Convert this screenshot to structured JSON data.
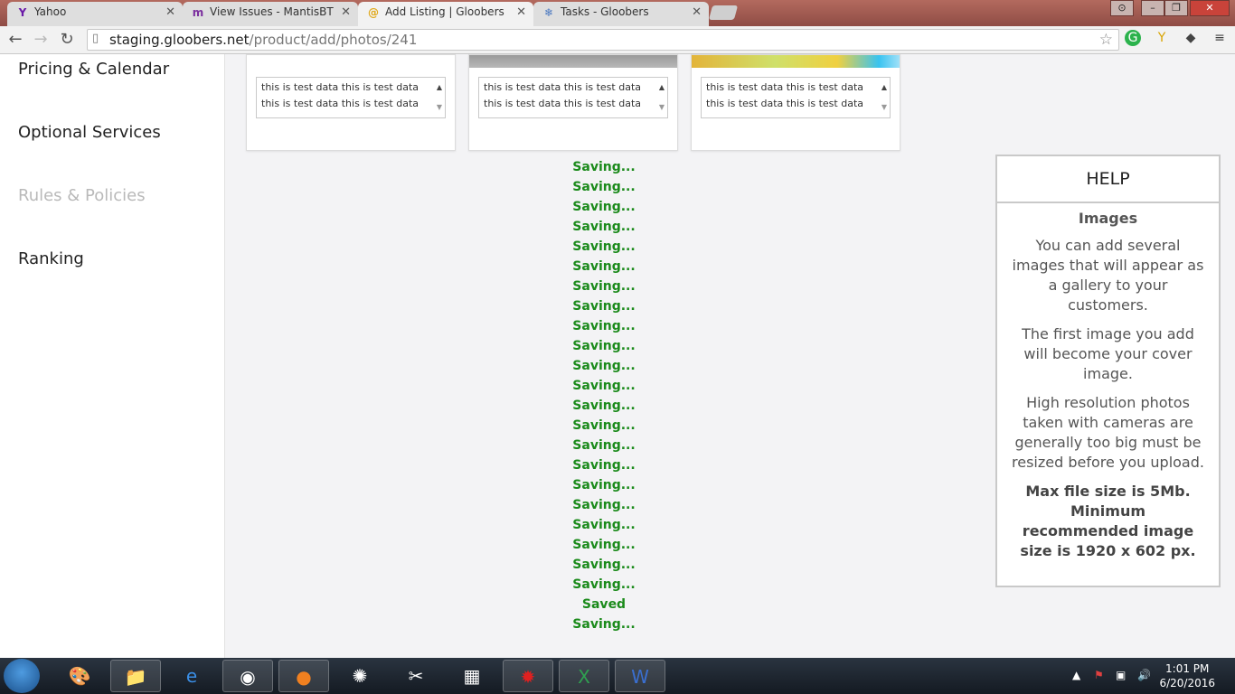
{
  "browser": {
    "tabs": [
      {
        "title": "Yahoo",
        "icon": "yahoo-icon",
        "active": false
      },
      {
        "title": "View Issues - MantisBT",
        "icon": "mantis-icon",
        "active": false
      },
      {
        "title": "Add Listing | Gloobers",
        "icon": "gloobers-icon",
        "active": true
      },
      {
        "title": "Tasks - Gloobers",
        "icon": "tasks-icon",
        "active": false
      }
    ],
    "url_host": "staging.gloobers.net",
    "url_path": "/product/add/photos/241"
  },
  "sidebar": {
    "items": [
      {
        "label": "Pricing & Calendar",
        "muted": false
      },
      {
        "label": "Optional Services",
        "muted": false
      },
      {
        "label": "Rules & Policies",
        "muted": true
      },
      {
        "label": "Ranking",
        "muted": false
      }
    ]
  },
  "photos": [
    {
      "caption": "this is test data this is test data this is test data this is test data"
    },
    {
      "caption": "this is test data this is test data this is test data this is test data"
    },
    {
      "caption": "this is test data this is test data this is test data this is test data"
    }
  ],
  "status_lines": [
    "Saving...",
    "Saving...",
    "Saving...",
    "Saving...",
    "Saving...",
    "Saving...",
    "Saving...",
    "Saving...",
    "Saving...",
    "Saving...",
    "Saving...",
    "Saving...",
    "Saving...",
    "Saving...",
    "Saving...",
    "Saving...",
    "Saving...",
    "Saving...",
    "Saving...",
    "Saving...",
    "Saving...",
    "Saving...",
    "Saved",
    "Saving..."
  ],
  "help": {
    "title": "HELP",
    "heading": "Images",
    "p1": "You can add several images that will appear as a gallery to your customers.",
    "p2": "The first image you add will become your cover image.",
    "p3": "High resolution photos taken with cameras are generally too big must be resized before you upload.",
    "p4": "Max file size is 5Mb. Minimum recommended image size is 1920 x 602 px."
  },
  "taskbar": {
    "time": "1:01 PM",
    "date": "6/20/2016"
  },
  "colors": {
    "saving_green": "#1a8a1a",
    "muted_text": "#b9b9b9"
  }
}
